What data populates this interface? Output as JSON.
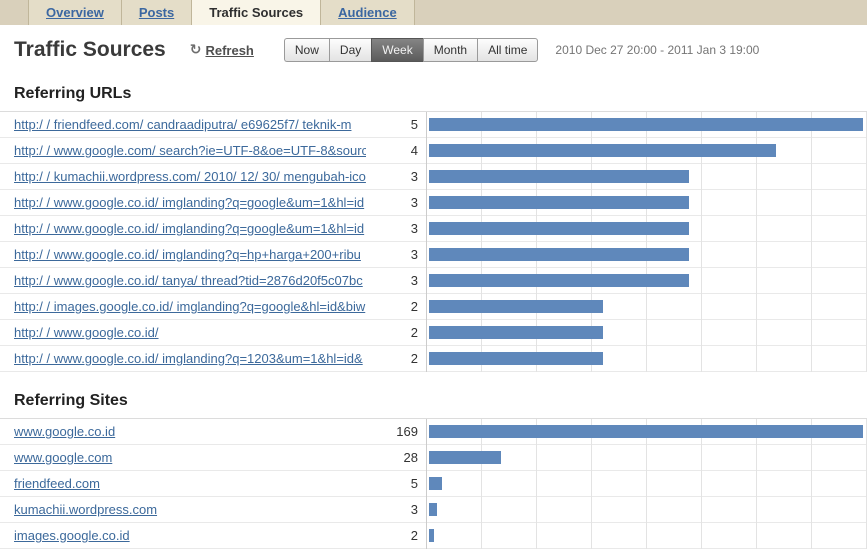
{
  "tabs": [
    {
      "label": "Overview",
      "active": false
    },
    {
      "label": "Posts",
      "active": false
    },
    {
      "label": "Traffic Sources",
      "active": true
    },
    {
      "label": "Audience",
      "active": false
    }
  ],
  "header": {
    "title": "Traffic Sources",
    "refresh_label": "Refresh",
    "date_range": "2010 Dec 27 20:00 - 2011 Jan 3 19:00"
  },
  "icons": {
    "refresh": "↻"
  },
  "time_buttons": {
    "options": [
      "Now",
      "Day",
      "Week",
      "Month",
      "All time"
    ],
    "selected": "Week"
  },
  "colors": {
    "bar": "#5f88bb",
    "link": "#3c699b",
    "tab_strip_bg": "#d9d0bb",
    "active_tab_bg": "#f9f5e8",
    "selected_button_bg": "#6b6b6b"
  },
  "sections": [
    {
      "title": "Referring URLs",
      "rows": [
        {
          "url": "http:/ / friendfeed.com/ candraadiputra/ e69625f7/ teknik-m",
          "count": 5
        },
        {
          "url": "http:/ / www.google.com/ search?ie=UTF-8&oe=UTF-8&sourc",
          "count": 4
        },
        {
          "url": "http:/ / kumachii.wordpress.com/ 2010/ 12/ 30/ mengubah-ico",
          "count": 3
        },
        {
          "url": "http:/ / www.google.co.id/ imglanding?q=google&um=1&hl=id",
          "count": 3
        },
        {
          "url": "http:/ / www.google.co.id/ imglanding?q=google&um=1&hl=id",
          "count": 3
        },
        {
          "url": "http:/ / www.google.co.id/ imglanding?q=hp+harga+200+ribu",
          "count": 3
        },
        {
          "url": "http:/ / www.google.co.id/ tanya/ thread?tid=2876d20f5c07bc",
          "count": 3
        },
        {
          "url": "http:/ / images.google.co.id/ imglanding?q=google&hl=id&biw",
          "count": 2
        },
        {
          "url": "http:/ / www.google.co.id/",
          "count": 2
        },
        {
          "url": "http:/ / www.google.co.id/ imglanding?q=1203&um=1&hl=id&",
          "count": 2
        }
      ]
    },
    {
      "title": "Referring Sites",
      "rows": [
        {
          "url": "www.google.co.id",
          "count": 169
        },
        {
          "url": "www.google.com",
          "count": 28
        },
        {
          "url": "friendfeed.com",
          "count": 5
        },
        {
          "url": "kumachii.wordpress.com",
          "count": 3
        },
        {
          "url": "images.google.co.id",
          "count": 2
        }
      ]
    }
  ]
}
